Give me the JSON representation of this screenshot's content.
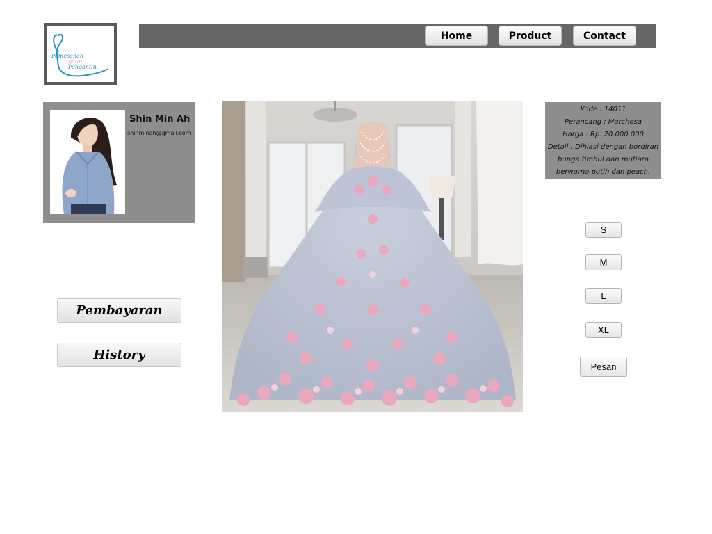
{
  "logo": {
    "line1": "Pemesanan",
    "line2": "gaun",
    "line3": "Pengantin",
    "icon": "heart-ribbon-icon",
    "colors": {
      "blue": "#2a8fc8",
      "pink": "#e0a0b8"
    }
  },
  "nav": {
    "home": "Home",
    "product": "Product",
    "contact": "Contact"
  },
  "profile": {
    "name": "Shin Min Ah",
    "email": "shinminah@gmail.com"
  },
  "side_menu": {
    "pembayaran": "Pembayaran",
    "history": "History"
  },
  "product": {
    "kode": "Kode : 14011",
    "perancang": "Perancang : Marchesa",
    "harga": "Harga : Rp. 20.000.000",
    "detail_line1": "Detail : Dihiasi dengan bordiran",
    "detail_line2": "bunga timbul dan mutiara",
    "detail_line3": "berwarna putih dan peach."
  },
  "sizes": {
    "s": "S",
    "m": "M",
    "l": "L",
    "xl": "XL"
  },
  "order_button": "Pesan",
  "colors": {
    "nav_bar": "#666666",
    "panel_gray": "#8e8e8e"
  }
}
